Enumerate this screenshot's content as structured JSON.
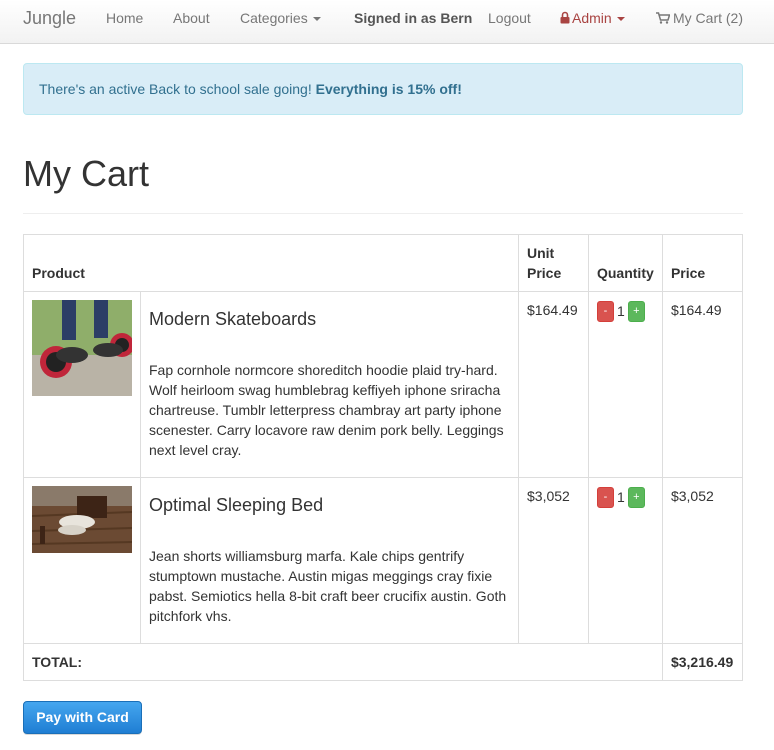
{
  "nav": {
    "brand": "Jungle",
    "home": "Home",
    "about": "About",
    "categories": "Categories",
    "signed_in": "Signed in as Bern",
    "logout": "Logout",
    "admin": "Admin",
    "cart": "My Cart (2)"
  },
  "alert": {
    "text": "There's an active Back to school sale going! ",
    "bold": "Everything is 15% off!"
  },
  "page": {
    "title": "My Cart"
  },
  "table": {
    "headers": {
      "product": "Product",
      "unit_price": "Unit Price",
      "quantity": "Quantity",
      "price": "Price"
    },
    "items": [
      {
        "name": "Modern Skateboards",
        "description": "Fap cornhole normcore shoreditch hoodie plaid try-hard. Wolf heirloom swag humblebrag keffiyeh iphone sriracha chartreuse. Tumblr letterpress chambray art party iphone scenester. Carry locavore raw denim pork belly. Leggings next level cray.",
        "unit_price": "$164.49",
        "quantity": "1",
        "price": "$164.49"
      },
      {
        "name": "Optimal Sleeping Bed",
        "description": "Jean shorts williamsburg marfa. Kale chips gentrify stumptown mustache. Austin migas meggings cray fixie pabst. Semiotics hella 8-bit craft beer crucifix austin. Goth pitchfork vhs.",
        "unit_price": "$3,052",
        "quantity": "1",
        "price": "$3,052"
      }
    ],
    "minus": "-",
    "plus": "+",
    "total_label": "TOTAL:",
    "total_value": "$3,216.49"
  },
  "pay_button": "Pay with Card",
  "colors": {
    "danger": "#d9534f",
    "success": "#5cb85c",
    "alert_bg": "#d9edf7",
    "alert_text": "#31708f",
    "admin": "#a94442",
    "pay_button": "#2b8fe3"
  }
}
